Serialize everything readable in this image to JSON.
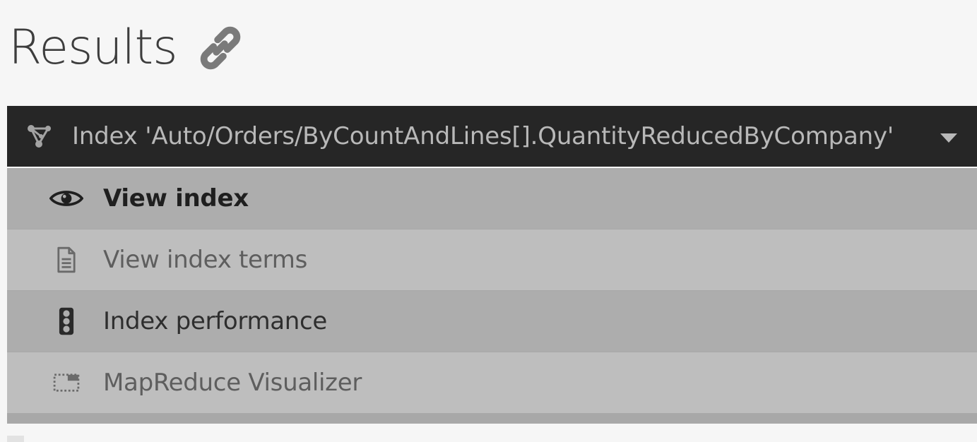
{
  "page": {
    "title": "Results"
  },
  "dropdown": {
    "label": "Index 'Auto/Orders/ByCountAndLines[].QuantityReducedByCompany'"
  },
  "menu": {
    "items": [
      {
        "label": "View index",
        "icon": "eye-icon"
      },
      {
        "label": "View index terms",
        "icon": "document-icon"
      },
      {
        "label": "Index performance",
        "icon": "traffic-light-icon"
      },
      {
        "label": "MapReduce Visualizer",
        "icon": "map-reduce-icon"
      }
    ]
  },
  "colors": {
    "header_bg": "#262626",
    "menu_dark": "#adadad",
    "menu_light": "#bebebe",
    "page_bg": "#f6f6f6"
  }
}
